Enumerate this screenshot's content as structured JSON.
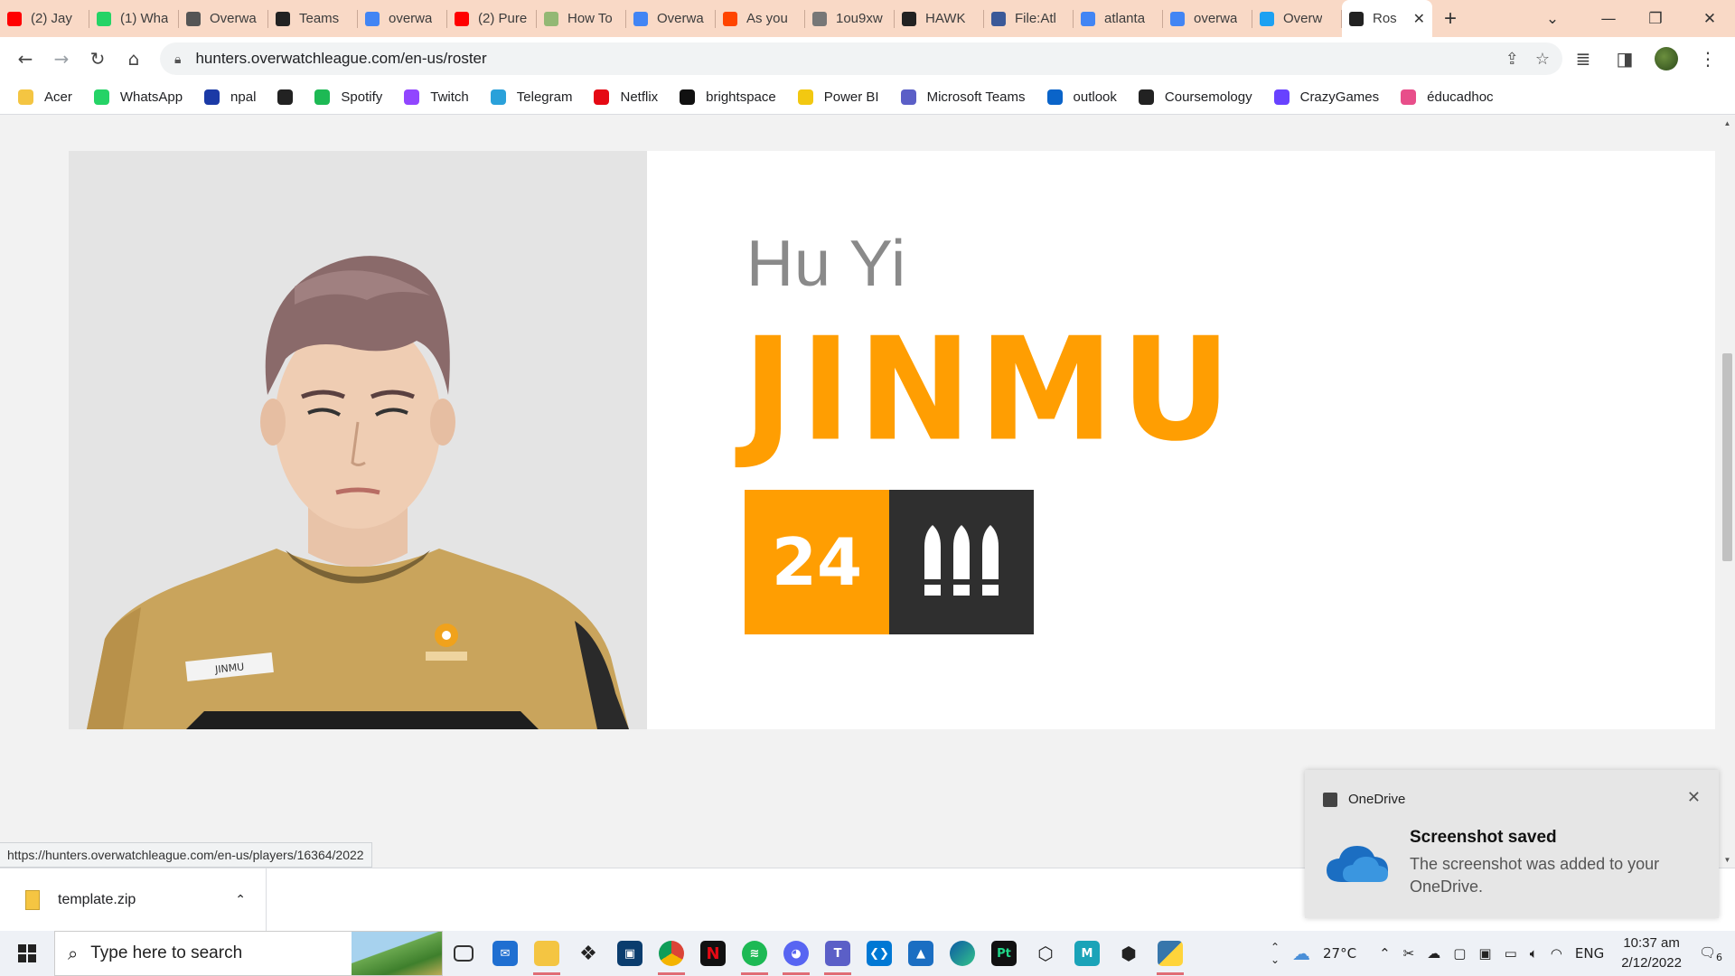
{
  "browser": {
    "tabs": [
      {
        "label": "(2) Jay",
        "icon": "youtube-icon",
        "color": "#ff0000"
      },
      {
        "label": "(1) Wha",
        "icon": "whatsapp-icon",
        "color": "#25d366"
      },
      {
        "label": "Overwa",
        "icon": "overwatch-icon",
        "color": "#555555"
      },
      {
        "label": "Teams",
        "icon": "hunters-icon",
        "color": "#222222"
      },
      {
        "label": "overwa",
        "icon": "google-icon",
        "color": "#4285f4"
      },
      {
        "label": "(2) Pure",
        "icon": "youtube-icon",
        "color": "#ff0000"
      },
      {
        "label": "How To",
        "icon": "wikihow-icon",
        "color": "#93b874"
      },
      {
        "label": "Overwa",
        "icon": "google-icon",
        "color": "#4285f4"
      },
      {
        "label": "As you",
        "icon": "reddit-icon",
        "color": "#ff4500"
      },
      {
        "label": "1ou9xw",
        "icon": "globe-icon",
        "color": "#777777"
      },
      {
        "label": "HAWK",
        "icon": "hunters-icon",
        "color": "#222222"
      },
      {
        "label": "File:Atl",
        "icon": "wiki-icon",
        "color": "#3b5998"
      },
      {
        "label": "atlanta",
        "icon": "google-icon",
        "color": "#4285f4"
      },
      {
        "label": "overwa",
        "icon": "google-icon",
        "color": "#4285f4"
      },
      {
        "label": "Overw",
        "icon": "twitter-icon",
        "color": "#1da1f2"
      }
    ],
    "active_tab": {
      "label": "Ros",
      "icon": "hunters-icon",
      "close": "✕"
    },
    "new_tab": "+",
    "url": "hunters.overwatchleague.com/en-us/roster",
    "bookmarks": [
      {
        "label": "Acer",
        "icon": "folder-icon",
        "color": "#f4c542"
      },
      {
        "label": "WhatsApp",
        "icon": "whatsapp-icon",
        "color": "#25d366"
      },
      {
        "label": "npal",
        "icon": "npal-icon",
        "color": "#1b3aa6"
      },
      {
        "label": "",
        "icon": "globe-icon",
        "color": "#222222"
      },
      {
        "label": "Spotify",
        "icon": "spotify-icon",
        "color": "#1db954"
      },
      {
        "label": "Twitch",
        "icon": "twitch-icon",
        "color": "#9146ff"
      },
      {
        "label": "Telegram",
        "icon": "telegram-icon",
        "color": "#2aa1da"
      },
      {
        "label": "Netflix",
        "icon": "netflix-icon",
        "color": "#e50914"
      },
      {
        "label": "brightspace",
        "icon": "np-icon",
        "color": "#111111"
      },
      {
        "label": "Power BI",
        "icon": "powerbi-icon",
        "color": "#f2c811"
      },
      {
        "label": "Microsoft Teams",
        "icon": "teams-icon",
        "color": "#5b5fc7"
      },
      {
        "label": "outlook",
        "icon": "outlook-icon",
        "color": "#0a64c9"
      },
      {
        "label": "Coursemology",
        "icon": "coursemology-icon",
        "color": "#222222"
      },
      {
        "label": "CrazyGames",
        "icon": "crazygames-icon",
        "color": "#6842ff"
      },
      {
        "label": "éducadhoc",
        "icon": "educadhoc-icon",
        "color": "#e84e8a"
      }
    ],
    "status_link": "https://hunters.overwatchleague.com/en-us/players/16364/2022"
  },
  "player": {
    "real_name": "Hu Yi",
    "handle": "JINMU",
    "number": "24",
    "role_icon": "damage-role-icon",
    "jersey_name": "JINMU",
    "accent_color": "#ff9e02",
    "role_bg_color": "#2f2f2f"
  },
  "toast": {
    "app": "OneDrive",
    "title": "Screenshot saved",
    "body": "The screenshot was added to your OneDrive.",
    "close": "✕"
  },
  "download": {
    "filename": "template.zip"
  },
  "taskbar": {
    "search_placeholder": "Type here to search",
    "weather": "27°C",
    "language": "ENG",
    "time": "10:37 am",
    "date": "2/12/2022",
    "notifications": "6"
  }
}
